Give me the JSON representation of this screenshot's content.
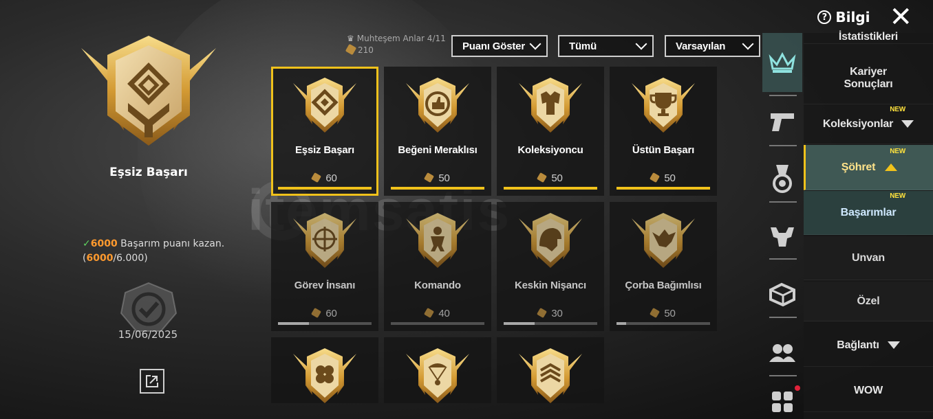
{
  "topbar": {
    "info_label": "Bilgi",
    "info_glyph": "?",
    "close_glyph": "✕"
  },
  "left_panel": {
    "title": "Eşsiz Başarı",
    "requirement": {
      "check": "✓",
      "amount": "6000",
      "text": " Başarım puanı kazan.",
      "progress_current": "6000",
      "progress_total": "/6.000"
    },
    "date": "15/06/2025"
  },
  "header": {
    "points_label": "Muhteşem Anlar 4/11",
    "points_value": "210",
    "filters": [
      {
        "label": "Puanı Göster"
      },
      {
        "label": "Tümü"
      },
      {
        "label": "Varsayılan"
      }
    ]
  },
  "achievements": [
    {
      "name": "Eşsiz Başarı",
      "score": "60",
      "progress": 1.0,
      "icon": "diamond-emblem-icon",
      "selected": true,
      "dim": false
    },
    {
      "name": "Beğeni Meraklısı",
      "score": "50",
      "progress": 1.0,
      "icon": "thumbs-up-icon",
      "selected": false,
      "dim": false
    },
    {
      "name": "Koleksiyoncu",
      "score": "50",
      "progress": 1.0,
      "icon": "outfit-icon",
      "selected": false,
      "dim": false
    },
    {
      "name": "Üstün Başarı",
      "score": "50",
      "progress": 1.0,
      "icon": "trophy-icon",
      "selected": false,
      "dim": false
    },
    {
      "name": "Görev İnsanı",
      "score": "60",
      "progress": 0.33,
      "icon": "crosshair-icon",
      "selected": false,
      "dim": true
    },
    {
      "name": "Komando",
      "score": "40",
      "progress": 0.0,
      "icon": "soldier-icon",
      "selected": false,
      "dim": true
    },
    {
      "name": "Keskin Nişancı",
      "score": "30",
      "progress": 0.33,
      "icon": "helmet-icon",
      "selected": false,
      "dim": true
    },
    {
      "name": "Çorba Bağımlısı",
      "score": "50",
      "progress": 0.1,
      "icon": "chicken-icon",
      "selected": false,
      "dim": true
    },
    {
      "name": "",
      "score": "",
      "progress": 0,
      "icon": "clover-icon",
      "selected": false,
      "dim": false
    },
    {
      "name": "",
      "score": "",
      "progress": 0,
      "icon": "parachute-icon",
      "selected": false,
      "dim": false
    },
    {
      "name": "",
      "score": "",
      "progress": 0,
      "icon": "rank-chevron-icon",
      "selected": false,
      "dim": false
    }
  ],
  "rail_icons": [
    "crown-icon",
    "pistol-icon",
    "medal-icon",
    "muscle-icon",
    "vehicle-icon",
    "friends-icon",
    "grid-icon"
  ],
  "menu": {
    "items": [
      {
        "label": "İstatistikleri"
      },
      {
        "label": "Kariyer Sonuçları"
      },
      {
        "label": "Koleksiyonlar",
        "new": "NEW"
      },
      {
        "label": "Şöhret",
        "new": "NEW"
      },
      {
        "label": "Başarımlar",
        "new": "NEW"
      },
      {
        "label": "Unvan"
      },
      {
        "label": "Özel"
      },
      {
        "label": "Bağlantı"
      },
      {
        "label": "WOW"
      }
    ]
  },
  "watermark": "itemsatis",
  "colors": {
    "accent": "#f1c21b",
    "gold": "#d8a640",
    "teal_active": "#3c5a58",
    "orange": "#ff9a2e",
    "check": "#5fd35f"
  }
}
